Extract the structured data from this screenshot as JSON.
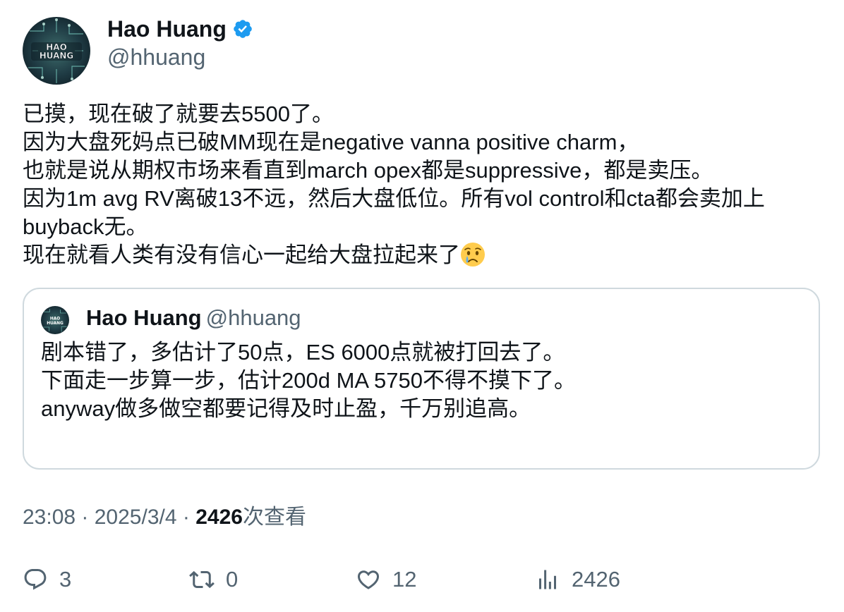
{
  "author": {
    "name": "Hao Huang",
    "handle": "@hhuang",
    "avatar_label": "HAO HUANG",
    "verified_icon": "verified-badge-icon",
    "verified_color": "#1d9bf0"
  },
  "tweet": {
    "lines": [
      "已摸，现在破了就要去5500了。",
      "因为大盘死妈点已破MM现在是negative vanna positive charm，",
      "也就是说从期权市场来看直到march opex都是suppressive，都是卖压。",
      "因为1m avg RV离破13不远，然后大盘低位。所有vol control和cta都会卖加上",
      "buyback无。",
      "现在就看人类有没有信心一起给大盘拉起来了"
    ],
    "emoji": "crying-face-emoji"
  },
  "quote": {
    "name": "Hao Huang",
    "handle": "@hhuang",
    "lines": [
      "剧本错了，多估计了50点，ES 6000点就被打回去了。",
      "下面走一步算一步，估计200d MA 5750不得不摸下了。",
      "anyway做多做空都要记得及时止盈，千万别追高。"
    ]
  },
  "meta": {
    "time": "23:08",
    "sep1": " · ",
    "date": "2025/3/4",
    "sep2": " · ",
    "views": "2426",
    "views_label": "次查看"
  },
  "actions": {
    "replies": "3",
    "retweets": "0",
    "likes": "12",
    "views": "2426"
  }
}
